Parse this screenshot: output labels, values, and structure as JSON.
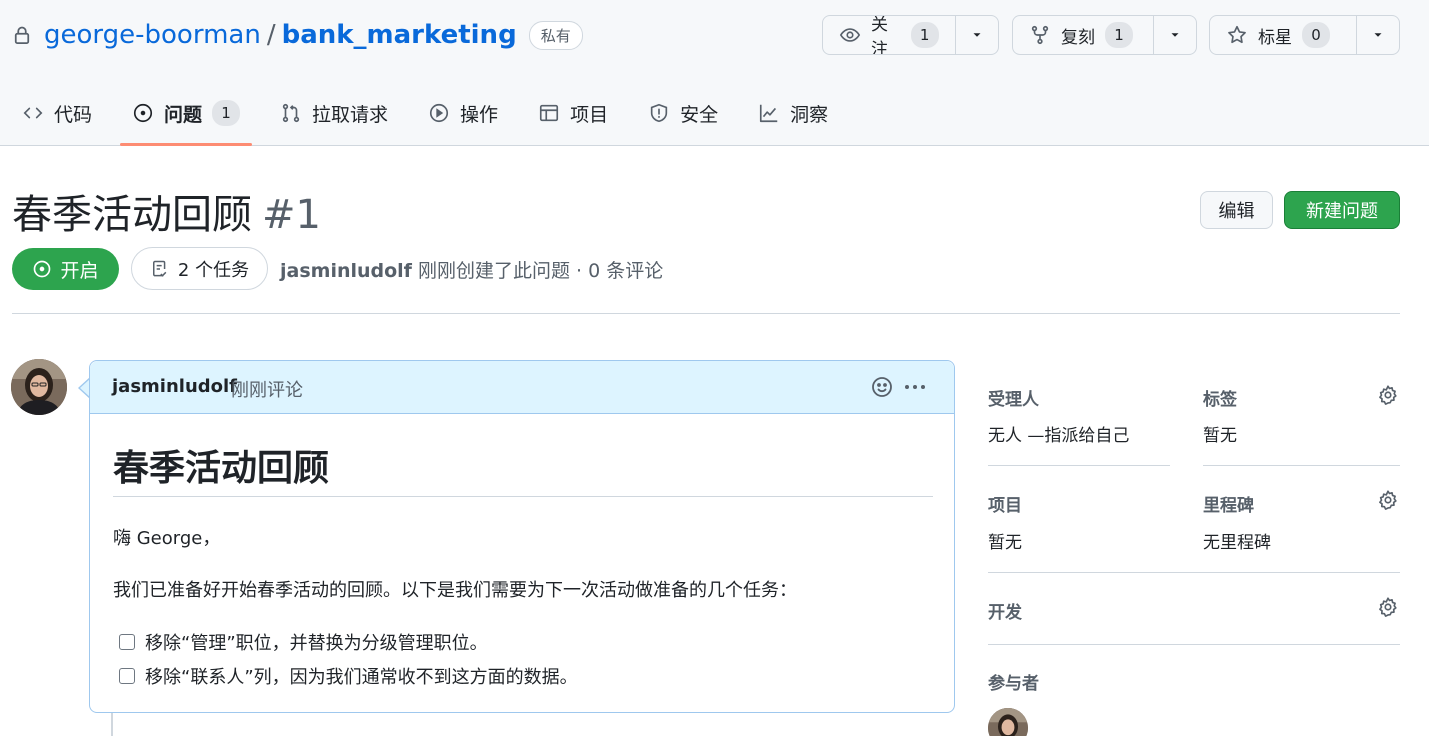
{
  "repo": {
    "owner": "george-boorman",
    "separator": "/",
    "name": "bank_marketing",
    "visibility": "私有"
  },
  "actions": {
    "watch": {
      "label": "关注",
      "count": "1"
    },
    "fork": {
      "label": "复刻",
      "count": "1"
    },
    "star": {
      "label": "标星",
      "count": "0"
    }
  },
  "nav": {
    "tabs": [
      {
        "label": "代码"
      },
      {
        "label": "问题",
        "count": "1",
        "selected": true
      },
      {
        "label": "拉取请求"
      },
      {
        "label": "操作"
      },
      {
        "label": "项目"
      },
      {
        "label": "安全"
      },
      {
        "label": "洞察"
      }
    ]
  },
  "issue": {
    "title": "春季活动回顾",
    "number": "#1",
    "state": "开启",
    "tasks": "2 个任务",
    "author": "jasminludolf",
    "meta_rest": " 刚刚创建了此问题 · 0 条评论",
    "edit_label": "编辑",
    "new_issue_label": "新建问题"
  },
  "comment": {
    "author": "jasminludolf",
    "time": "刚刚评论",
    "heading": "春季活动回顾",
    "greeting": "嗨 George，",
    "paragraph": "我们已准备好开始春季活动的回顾。以下是我们需要为下一次活动做准备的几个任务：",
    "tasks": [
      {
        "text": "移除“管理”职位，并替换为分级管理职位。",
        "checked": false
      },
      {
        "text": "移除“联系人”列，因为我们通常收不到这方面的数据。",
        "checked": false
      }
    ]
  },
  "sidebar": {
    "assignees": {
      "label": "受理人",
      "value": "无人 —指派给自己"
    },
    "labels": {
      "label": "标签",
      "value": "暂无"
    },
    "projects": {
      "label": "项目",
      "value": "暂无"
    },
    "milestone": {
      "label": "里程碑",
      "value": "无里程碑"
    },
    "development": {
      "label": "开发"
    },
    "participants": {
      "label": "参与者"
    }
  },
  "colors": {
    "link": "#0969da",
    "open_green": "#2da44e",
    "comment_header_bg": "#ddf4ff",
    "tab_underline": "#fd8c73"
  }
}
